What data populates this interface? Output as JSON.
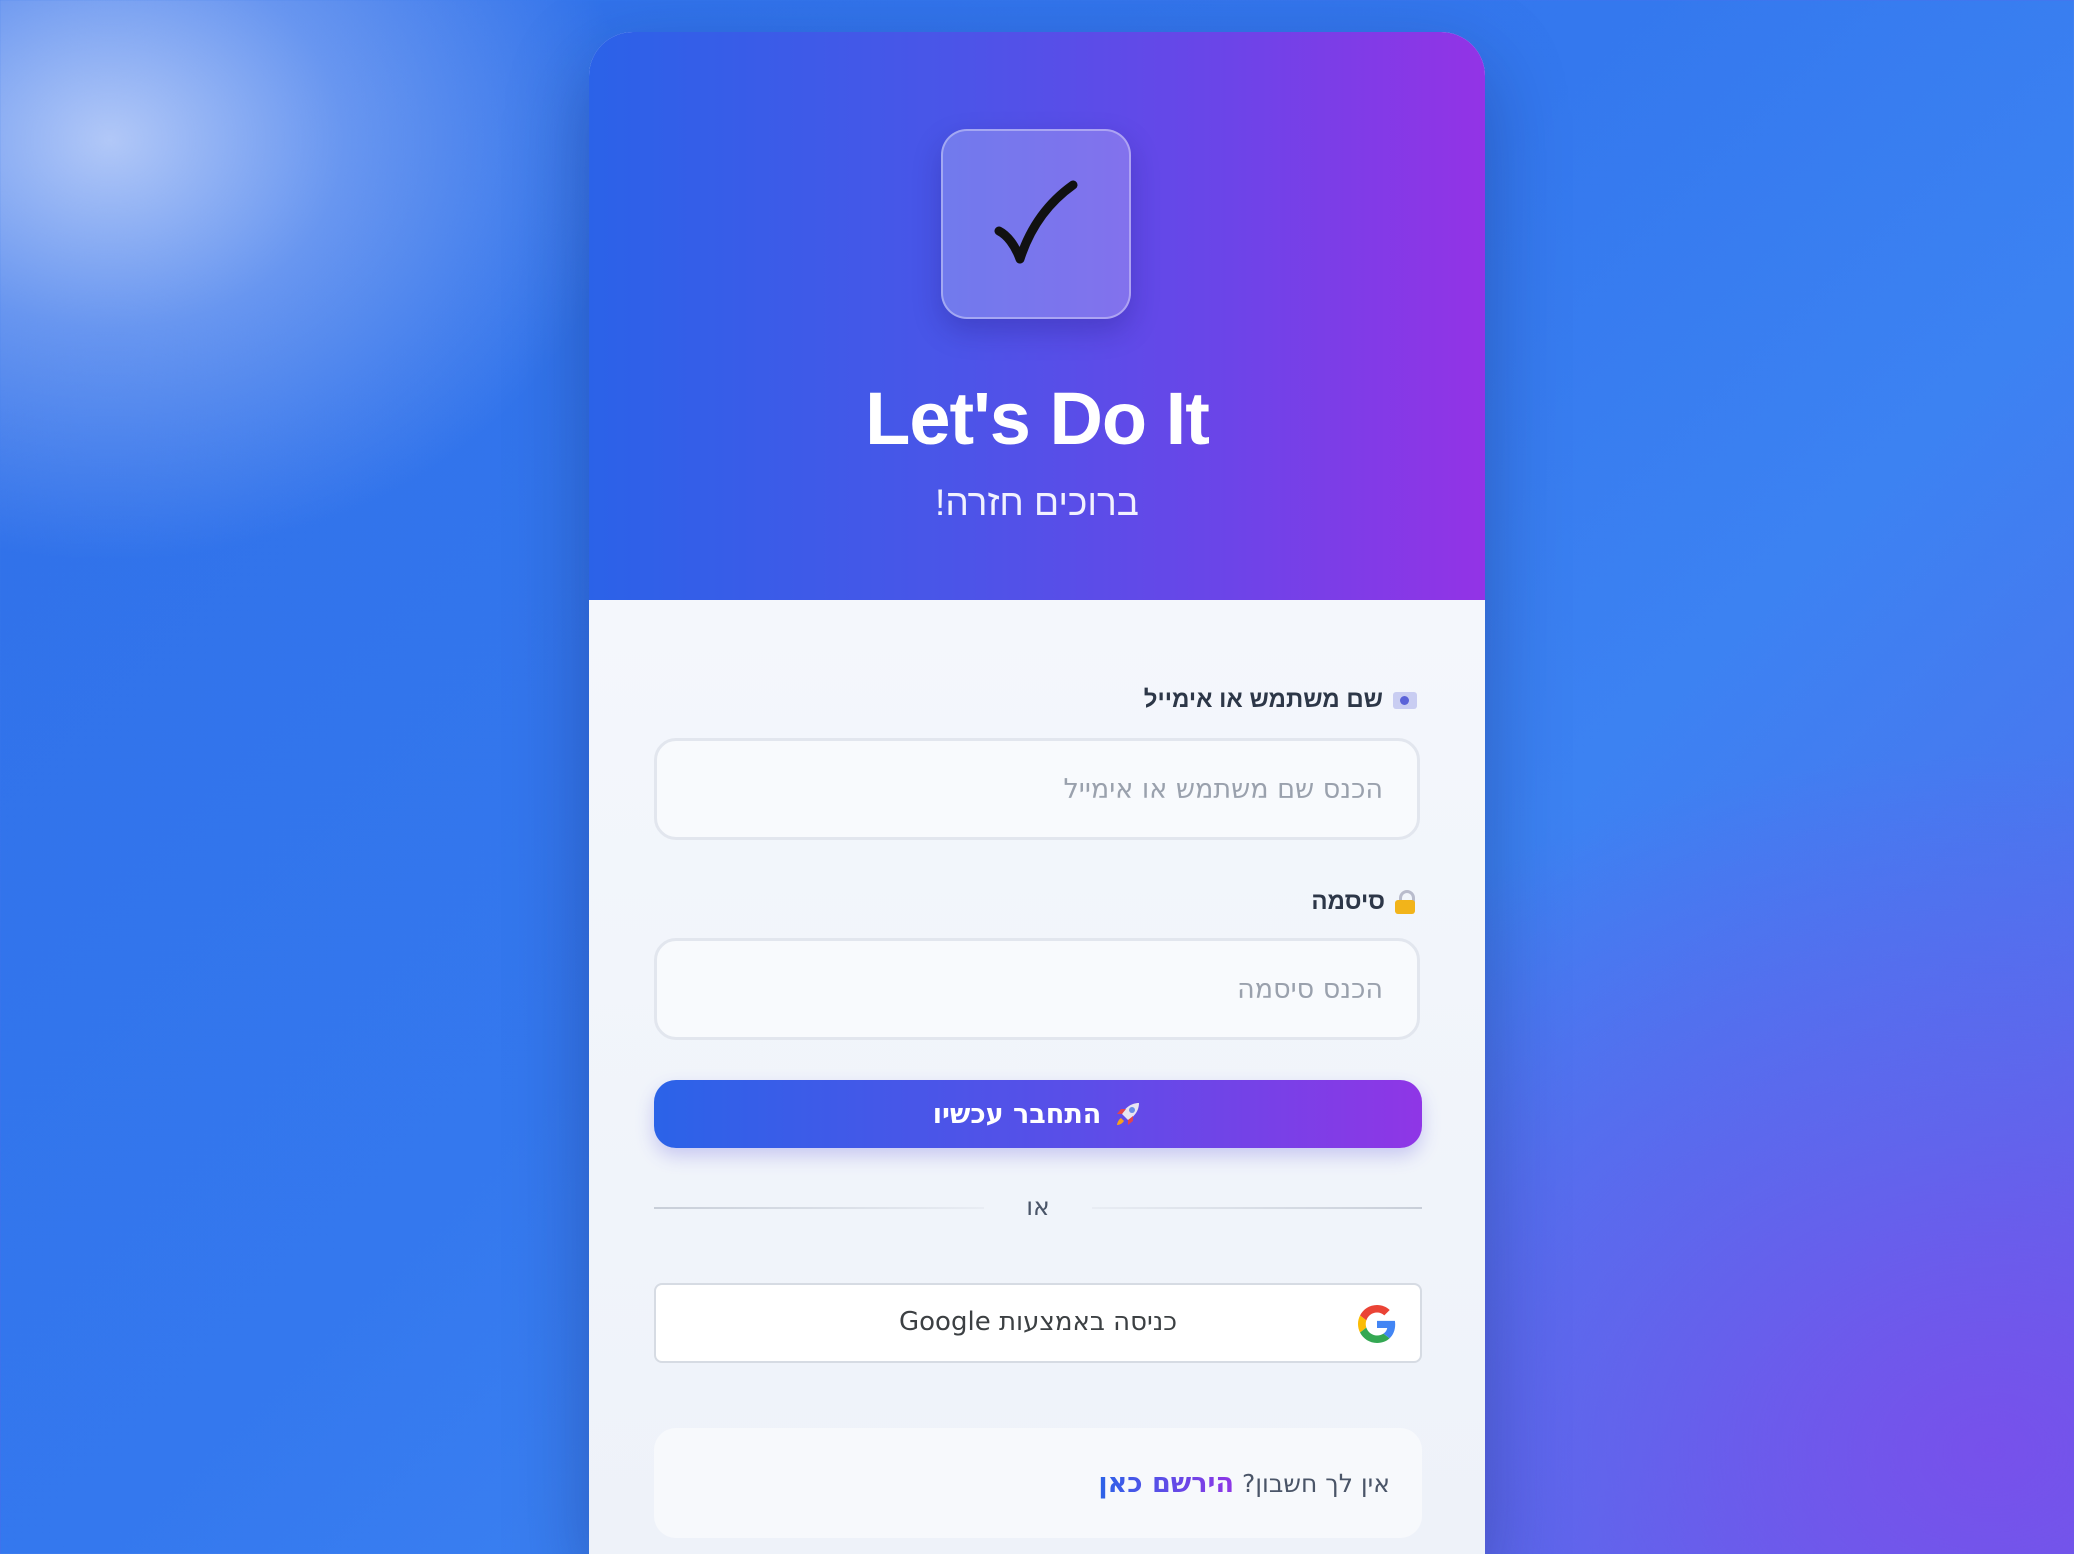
{
  "app": {
    "logo_icon": "checkmark-icon",
    "title": "Let's Do It",
    "subtitle": "ברוכים חזרה!"
  },
  "form": {
    "username": {
      "icon": "id-card-icon",
      "label": "שם משתמש או אימייל",
      "placeholder": "הכנס שם משתמש או אימייל",
      "value": ""
    },
    "password": {
      "icon": "lock-icon",
      "label": "סיסמה",
      "placeholder": "הכנס סיסמה",
      "value": ""
    },
    "submit": {
      "icon": "rocket-icon",
      "label": "התחבר עכשיו"
    },
    "divider_text": "או",
    "google": {
      "icon": "google-icon",
      "label": "כניסה באמצעות Google"
    }
  },
  "signup": {
    "prompt": "אין לך חשבון?",
    "link_label": "הירשם כאן"
  },
  "colors": {
    "brand_gradient_start": "#2b63e8",
    "brand_gradient_end": "#9333e6",
    "background": "#3478ee"
  }
}
